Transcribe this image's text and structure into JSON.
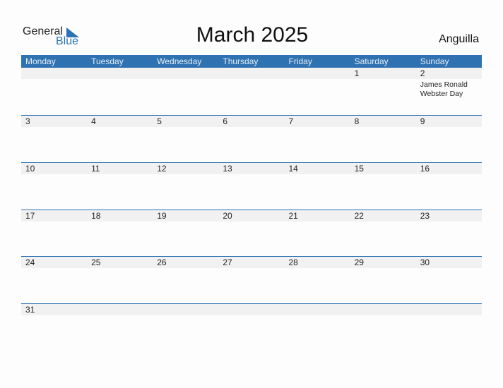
{
  "logo": {
    "general": "General",
    "blue": "Blue"
  },
  "title": "March 2025",
  "country": "Anguilla",
  "weekdays": [
    "Monday",
    "Tuesday",
    "Wednesday",
    "Thursday",
    "Friday",
    "Saturday",
    "Sunday"
  ],
  "weeks": [
    {
      "days": [
        "",
        "",
        "",
        "",
        "",
        "1",
        "2"
      ],
      "events": [
        "",
        "",
        "",
        "",
        "",
        "",
        "James Ronald Webster Day"
      ]
    },
    {
      "days": [
        "3",
        "4",
        "5",
        "6",
        "7",
        "8",
        "9"
      ],
      "events": [
        "",
        "",
        "",
        "",
        "",
        "",
        ""
      ]
    },
    {
      "days": [
        "10",
        "11",
        "12",
        "13",
        "14",
        "15",
        "16"
      ],
      "events": [
        "",
        "",
        "",
        "",
        "",
        "",
        ""
      ]
    },
    {
      "days": [
        "17",
        "18",
        "19",
        "20",
        "21",
        "22",
        "23"
      ],
      "events": [
        "",
        "",
        "",
        "",
        "",
        "",
        ""
      ]
    },
    {
      "days": [
        "24",
        "25",
        "26",
        "27",
        "28",
        "29",
        "30"
      ],
      "events": [
        "",
        "",
        "",
        "",
        "",
        "",
        ""
      ]
    },
    {
      "days": [
        "31",
        "",
        "",
        "",
        "",
        "",
        ""
      ],
      "events": [
        "",
        "",
        "",
        "",
        "",
        "",
        ""
      ]
    }
  ]
}
